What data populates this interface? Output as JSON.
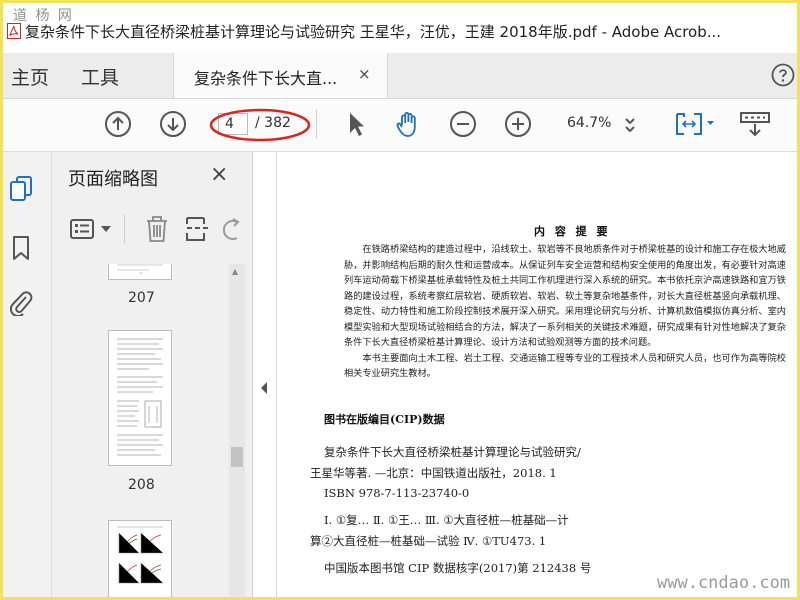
{
  "window": {
    "title": "复杂条件下长大直径桥梁桩基计算理论与试验研究 王星华，汪优，王建 2018年版.pdf - Adobe Acrob...",
    "watermark_top": "道  杨  网"
  },
  "tabs": {
    "home": "主页",
    "tools": "工具",
    "document": "复杂条件下长大直...",
    "close": "×"
  },
  "toolbar": {
    "current_page": "4",
    "total_pages": "/ 382",
    "zoom": "64.7%"
  },
  "panel": {
    "title": "页面缩略图",
    "close": "×",
    "thumbs": [
      {
        "label": "207"
      },
      {
        "label": "208"
      }
    ]
  },
  "document": {
    "heading": "内 容 提 要",
    "paragraph1": "在铁路桥梁结构的建造过程中，沿线软土、软岩等不良地质条件对于桥梁桩基的设计和施工存在极大地威胁，并影响结构后期的耐久性和运营成本。从保证列车安全运营和结构安全使用的角度出发，有必要针对高速列车运动荷载下桥梁基桩承载特性及桩土共同工作机理进行深入系统的研究。本书依托京沪高速铁路和宜万铁路的建设过程，系统考察红层软岩、硬质软岩、软岩、软土等复杂地基条件，对长大直径桩基竖向承载机理、稳定性、动力特性和施工阶段控制技术展开深入研究。采用理论研究与分析、计算机数值模拟仿真分析、室内模型实验和大型现场试验相结合的方法，解决了一系列相关的关键技术难题，研究成果有针对性地解决了复杂条件下长大直径桥梁桩基计算理论、设计方法和试验观测等方面的技术问题。",
    "paragraph2": "本书主要面向土木工程、岩土工程、交通运输工程等专业的工程技术人员和研究人员，也可作为高等院校相关专业研究生教材。",
    "cip_title": "图书在版编目(CIP)数据",
    "cip_line1": "复杂条件下长大直径桥梁桩基计算理论与试验研究/",
    "cip_line2": "王星华等著. —北京：中国铁道出版社，2018. 1",
    "cip_line3": "ISBN 978-7-113-23740-0",
    "cip_line4": "Ⅰ. ①复…  Ⅱ. ①王…  Ⅲ. ①大直径桩—桩基础—计",
    "cip_line5": "算②大直径桩—桩基础—试验  Ⅳ. ①TU473. 1",
    "cip_line6": "中国版本图书馆 CIP 数据核字(2017)第 212438 号"
  },
  "watermark_bottom": "www.cndao.com",
  "colors": {
    "frame_yellow": "#f4e15a",
    "accent_blue": "#1f6fc5",
    "annotation_red": "#d9261c"
  }
}
